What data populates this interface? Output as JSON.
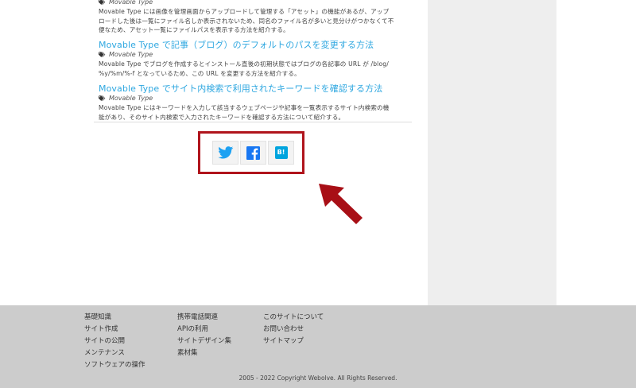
{
  "articles": [
    {
      "tag": "Movable Type",
      "desc_lines": [
        "Movable Type には画像を管理画面からアップロードして管理する「アセット」の機能があるが、アップ",
        "ロードした後は一覧にファイル名しか表示されないため、同名のファイル名が多いと見分けがつかなくて不",
        "便なため、アセット一覧にファイルパスを表示する方法を紹介する。"
      ]
    },
    {
      "title": "Movable Type で記事（ブログ）のデフォルトのパスを変更する方法",
      "tag": "Movable Type",
      "desc_lines": [
        "Movable Type でブログを作成するとインストール直後の初期状態ではブログの各記事の URL が /blog/",
        "%y/%m/%-f となっているため、この URL を変更する方法を紹介する。"
      ]
    },
    {
      "title": "Movable Type でサイト内検索で利用されたキーワードを確認する方法",
      "tag": "Movable Type",
      "desc_lines": [
        "Movable Type にはキーワードを入力して該当するウェブページや記事を一覧表示するサイト内検索の機",
        "能があり、そのサイト内検索で入力されたキーワードを確認する方法について紹介する。"
      ]
    }
  ],
  "share": {
    "icons": [
      "twitter-icon",
      "facebook-icon",
      "hatena-bookmark-icon"
    ],
    "hatena_label": "B!",
    "highlight_color": "#b0141c",
    "twitter_color": "#1da1f2",
    "facebook_color": "#1877f2",
    "hatena_color": "#00a4de"
  },
  "annotation": {
    "arrow_color": "#a80f16"
  },
  "footer": {
    "col1": [
      "基礎知識",
      "サイト作成",
      "サイトの公開",
      "メンテナンス",
      "ソフトウェアの操作"
    ],
    "col2": [
      "携帯電話関連",
      "APIの利用",
      "サイトデザイン集",
      "素材集"
    ],
    "col3": [
      "このサイトについて",
      "お問い合わせ",
      "サイトマップ"
    ],
    "copyright": "2005 - 2022 Copyright Webolve. All Rights Reserved."
  },
  "colors": {
    "link": "#2ea7e0",
    "sidebar_bg": "#eeeeee",
    "footer_bg": "#cccccc"
  }
}
